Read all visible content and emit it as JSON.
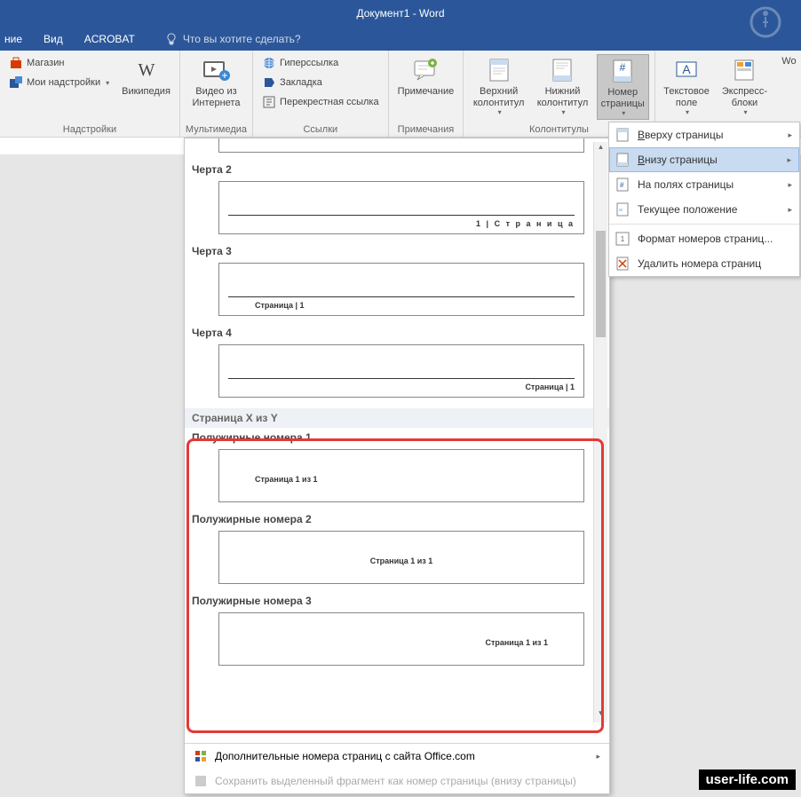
{
  "window": {
    "title": "Документ1 - Word"
  },
  "menubar": {
    "items": [
      "ние",
      "Вид",
      "ACROBAT"
    ],
    "tell_me": "Что вы хотите сделать?"
  },
  "ribbon": {
    "addins_group": {
      "label": "Надстройки",
      "store": "Магазин",
      "my_addins": "Мои надстройки",
      "wikipedia": "Википедия"
    },
    "media_group": {
      "label": "Мультимедиа",
      "online_video": "Видео из Интернета"
    },
    "links_group": {
      "label": "Ссылки",
      "hyperlink": "Гиперссылка",
      "bookmark": "Закладка",
      "crossref": "Перекрестная ссылка"
    },
    "comments_group": {
      "label": "Примечания",
      "comment": "Примечание"
    },
    "headerfooter_group": {
      "label": "Колонтитулы",
      "header": "Верхний колонтитул",
      "footer": "Нижний колонтитул",
      "page_number": "Номер страницы"
    },
    "text_group": {
      "textbox": "Текстовое поле",
      "quickparts": "Экспресс-блоки",
      "wordart_stub": "Wo"
    }
  },
  "page_number_menu": {
    "top": "Вверху страницы",
    "bottom": "Внизу страницы",
    "margins": "На полях страницы",
    "current": "Текущее положение",
    "format": "Формат номеров страниц...",
    "remove": "Удалить номера страниц"
  },
  "gallery": {
    "items": [
      {
        "title": "Черта 2",
        "num_text": "1 | С т р а н и ц а",
        "align": "right"
      },
      {
        "title": "Черта 3",
        "num_text": "Страница | 1",
        "align": "left"
      },
      {
        "title": "Черта 4",
        "num_text": "Страница | 1",
        "align": "right"
      }
    ],
    "section_title": "Страница X из Y",
    "bold_items": [
      {
        "title": "Полужирные номера 1",
        "num_text": "Страница 1 из 1",
        "align": "left"
      },
      {
        "title": "Полужирные номера 2",
        "num_text": "Страница 1 из 1",
        "align": "center"
      },
      {
        "title": "Полужирные номера 3",
        "num_text": "Страница 1 из 1",
        "align": "right"
      }
    ],
    "more_office": "Дополнительные номера страниц с сайта Office.com",
    "save_selection": "Сохранить выделенный фрагмент как номер страницы (внизу страницы)"
  },
  "watermark": "user-life.com"
}
